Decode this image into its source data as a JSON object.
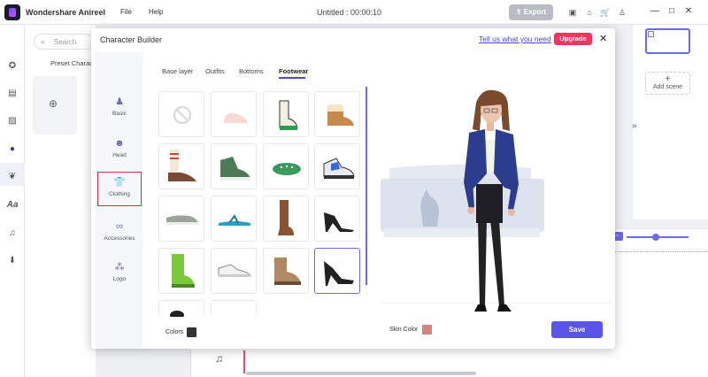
{
  "app": {
    "title": "Wondershare Anireel",
    "menu": [
      "File",
      "Help"
    ],
    "document_title": "Untitled : 00:00:10",
    "export_label": "Export"
  },
  "library": {
    "search_placeholder": "Search",
    "preset_label": "Preset Characte"
  },
  "right_panel": {
    "add_scene_label": "Add scene"
  },
  "dialog": {
    "title": "Character Builder",
    "feedback_link": "Tell us what you need",
    "upgrade_label": "Upgrade",
    "categories": [
      {
        "label": "Basic",
        "icon": "person-icon"
      },
      {
        "label": "Head",
        "icon": "head-icon"
      },
      {
        "label": "Clothing",
        "icon": "shirt-icon",
        "selected": true
      },
      {
        "label": "Accessories",
        "icon": "glasses-icon"
      },
      {
        "label": "Logo",
        "icon": "logo-icon"
      }
    ],
    "tabs": [
      "Base layer",
      "Outfits",
      "Bottoms",
      "Footwear"
    ],
    "active_tab": "Footwear",
    "items": [
      "none",
      "pink-flats",
      "chelsea-boots",
      "fur-boots",
      "striped-socks-shoes",
      "green-high-tops",
      "green-clogs",
      "sport-sneakers",
      "grey-slip-ons",
      "teal-flip-flops",
      "tall-brown-boots",
      "black-strappy-heels",
      "green-rain-boots",
      "white-sneakers",
      "tan-work-boots",
      "black-pumps",
      "black-shoe-partial",
      "empty"
    ],
    "selected_item_index": 15,
    "colors_label": "Colors",
    "skin_color_label": "Skin Color",
    "save_label": "Save",
    "accent_color": "#5a55e8",
    "upgrade_color": "#f0365f"
  }
}
